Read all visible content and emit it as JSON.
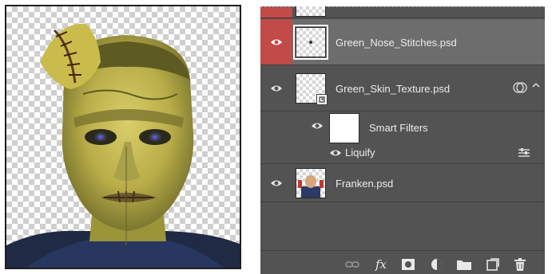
{
  "layers_panel": {
    "layers": [
      {
        "id": "green-nose-stitches",
        "name": "Green_Nose_Stitches.psd",
        "visible": true,
        "selected": true
      },
      {
        "id": "green-skin-texture",
        "name": "Green_Skin_Texture.psd",
        "visible": true,
        "selected": false,
        "smart_object": true
      },
      {
        "id": "smart-filters",
        "name": "Smart Filters",
        "visible": true,
        "is_filter_group": true
      },
      {
        "id": "liquify",
        "name": "Liquify",
        "visible": true,
        "is_filter": true
      },
      {
        "id": "franken",
        "name": "Franken.psd",
        "visible": true,
        "selected": false
      }
    ],
    "bottom_bar_icons": [
      "link-icon",
      "fx-icon",
      "add-mask-icon",
      "adjustment-layer-icon",
      "new-group-icon",
      "new-layer-icon",
      "trash-icon"
    ],
    "fx_label": "fx"
  },
  "colors": {
    "panel_bg": "#535353",
    "selected_row_bg": "#6d6d6d",
    "visibility_highlight": "#c24a48"
  }
}
